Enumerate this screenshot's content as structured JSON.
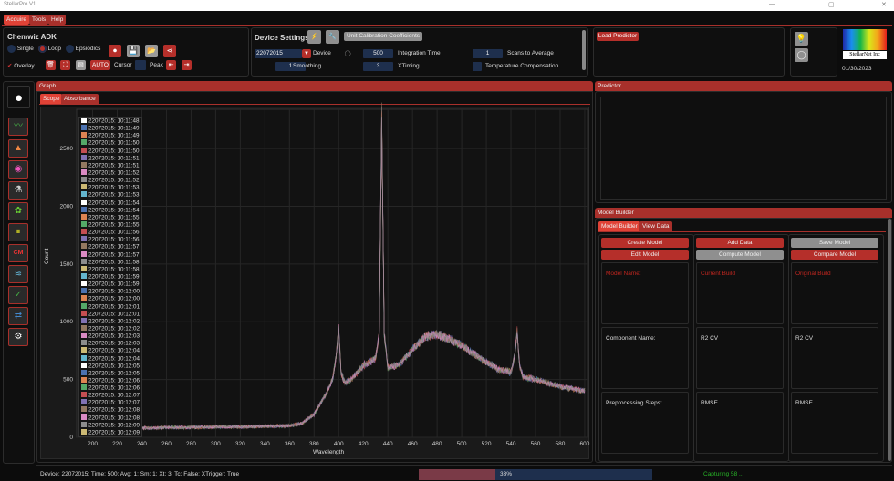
{
  "window": {
    "title": "StellarPro V1",
    "controls": [
      "—",
      "▢",
      "✕"
    ]
  },
  "menu": {
    "tabs": [
      "Acquire",
      "Tools",
      "Help"
    ],
    "active": "Acquire"
  },
  "acquire": {
    "title": "Chemwiz ADK",
    "modes": [
      "Single",
      "Loop",
      "Epsiodics"
    ],
    "mode_selected": "Loop",
    "overlay_label": "Overlay",
    "auto_label": "AUTO",
    "cursor_label": "Cursor",
    "peak_label": "Peak"
  },
  "device": {
    "title": "Device Settings",
    "calib_button": "Unit Calibration Coefficients",
    "device_value": "22072015",
    "device_label": "Device",
    "integration_value": "500",
    "integration_label": "Integration Time",
    "scans_value": "1",
    "scans_label": "Scans to Average",
    "smoothing_value": "1",
    "smoothing_label": "Smoothing",
    "xtiming_value": "3",
    "xtiming_label": "XTiming",
    "temp_label": "Temperature Compensation"
  },
  "predictor_load": {
    "button": "Load Predictor"
  },
  "logo": {
    "text": "StellarNet Inc",
    "date": "01/30/2023"
  },
  "graph": {
    "title": "Graph",
    "tabs": [
      "Scope",
      "Absorbance"
    ],
    "active_tab": "Scope"
  },
  "predictor": {
    "title": "Predictor"
  },
  "model_builder": {
    "title": "Model Builder",
    "tabs": [
      "Model Builder",
      "View Data"
    ],
    "buttons": [
      [
        "Create Model",
        "Edit Model"
      ],
      [
        "Add Data",
        "Compute Model"
      ],
      [
        "Save Model",
        "Compare Model"
      ]
    ],
    "cells": [
      [
        "Model Name:",
        "Component Name:",
        "Preprocessing Steps:"
      ],
      [
        "Current Build",
        "R2 CV",
        "RMSE"
      ],
      [
        "Original Build",
        "R2 CV",
        "RMSE"
      ]
    ]
  },
  "status": {
    "text": "Device: 22072015; Time: 500; Avg: 1; Sm: 1; Xt: 3; Tc: False; XTrigger: True",
    "progress_percent": 33,
    "progress_label": "33%",
    "capture": "Capturing 58 ..."
  },
  "colors": {
    "accent": "#a8302b",
    "active": "#e04236",
    "field": "#1e2f4d",
    "progress_done": "#7a3a47",
    "progress_rest": "#1e2f4d",
    "capture": "#27b327"
  },
  "chart_data": {
    "type": "line",
    "xlabel": "Wavelength",
    "ylabel": "Count",
    "xlim": [
      187,
      603
    ],
    "ylim": [
      0,
      2840
    ],
    "xticks": [
      200,
      220,
      240,
      260,
      280,
      300,
      320,
      340,
      360,
      380,
      400,
      420,
      440,
      460,
      480,
      500,
      520,
      540,
      560,
      580,
      600
    ],
    "yticks": [
      0,
      500,
      1000,
      1500,
      2000,
      2500
    ],
    "grid": true,
    "legend_placement": "top-left",
    "profile_x": [
      240,
      260,
      280,
      300,
      320,
      340,
      360,
      370,
      380,
      390,
      395,
      398,
      400,
      402,
      405,
      410,
      420,
      430,
      433,
      435,
      437,
      440,
      450,
      460,
      470,
      480,
      490,
      500,
      510,
      520,
      530,
      540,
      543,
      545,
      547,
      550,
      560,
      570,
      580,
      590,
      600
    ],
    "profile_y": [
      80,
      85,
      85,
      90,
      90,
      95,
      100,
      120,
      200,
      380,
      500,
      700,
      960,
      550,
      470,
      500,
      620,
      680,
      900,
      2820,
      900,
      600,
      640,
      760,
      870,
      890,
      850,
      800,
      720,
      650,
      590,
      560,
      700,
      920,
      620,
      520,
      500,
      470,
      440,
      420,
      400
    ],
    "legend": [
      "22072015: 10:11:48",
      "22072015: 10:11:49",
      "22072015: 10:11:49",
      "22072015: 10:11:50",
      "22072015: 10:11:50",
      "22072015: 10:11:51",
      "22072015: 10:11:51",
      "22072015: 10:11:52",
      "22072015: 10:11:52",
      "22072015: 10:11:53",
      "22072015: 10:11:53",
      "22072015: 10:11:54",
      "22072015: 10:11:54",
      "22072015: 10:11:55",
      "22072015: 10:11:55",
      "22072015: 10:11:56",
      "22072015: 10:11:56",
      "22072015: 10:11:57",
      "22072015: 10:11:57",
      "22072015: 10:11:58",
      "22072015: 10:11:58",
      "22072015: 10:11:59",
      "22072015: 10:11:59",
      "22072015: 10:12:00",
      "22072015: 10:12:00",
      "22072015: 10:12:01",
      "22072015: 10:12:01",
      "22072015: 10:12:02",
      "22072015: 10:12:02",
      "22072015: 10:12:03",
      "22072015: 10:12:03",
      "22072015: 10:12:04",
      "22072015: 10:12:04",
      "22072015: 10:12:05",
      "22072015: 10:12:05",
      "22072015: 10:12:06",
      "22072015: 10:12:06",
      "22072015: 10:12:07",
      "22072015: 10:12:07",
      "22072015: 10:12:08",
      "22072015: 10:12:08",
      "22072015: 10:12:09",
      "22072015: 10:12:09"
    ],
    "series_colors": [
      "#ffffff",
      "#4c72b0",
      "#dd8452",
      "#55a868",
      "#c44e52",
      "#8172b3",
      "#937860",
      "#da8bc3",
      "#8c8c8c",
      "#ccb974",
      "#64b5cd"
    ]
  }
}
